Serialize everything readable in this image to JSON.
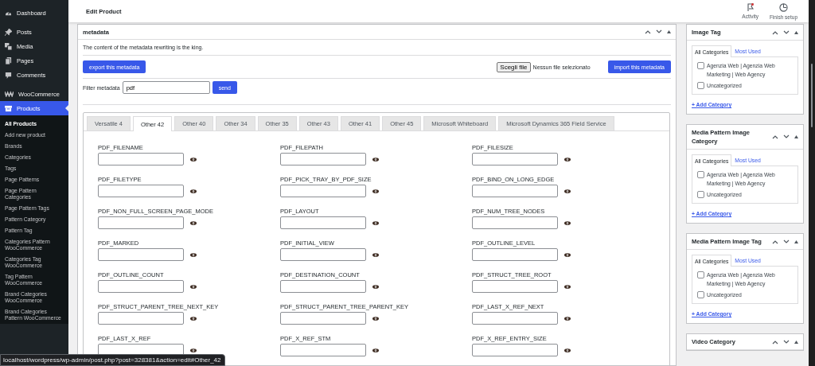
{
  "sidebar": {
    "menu": [
      {
        "label": "Dashboard",
        "kind": "dashboard",
        "selected": false
      },
      {
        "label": "Posts",
        "kind": "posts",
        "selected": false
      },
      {
        "label": "Media",
        "kind": "media",
        "selected": false
      },
      {
        "label": "Pages",
        "kind": "pages",
        "selected": false
      },
      {
        "label": "Comments",
        "kind": "comments",
        "selected": false
      },
      {
        "label": "WooCommerce",
        "kind": "woo",
        "selected": false
      },
      {
        "label": "Products",
        "kind": "products",
        "selected": true
      }
    ],
    "submenu": [
      {
        "label": "All Products",
        "selected": true
      },
      {
        "label": "Add new product",
        "selected": false
      },
      {
        "label": "Brands",
        "selected": false
      },
      {
        "label": "Categories",
        "selected": false
      },
      {
        "label": "Tags",
        "selected": false
      },
      {
        "label": "Page Patterns",
        "selected": false
      },
      {
        "label": "Page Pattern Categories",
        "selected": false
      },
      {
        "label": "Page Pattern Tags",
        "selected": false
      },
      {
        "label": "Pattern Category",
        "selected": false
      },
      {
        "label": "Pattern Tag",
        "selected": false
      },
      {
        "label": "Categories Pattern WooCommerce",
        "selected": false
      },
      {
        "label": "Categories Tag WooCommerce",
        "selected": false
      },
      {
        "label": "Tag Pattern WooCommerce",
        "selected": false
      },
      {
        "label": "Brand Categories WooCommerce",
        "selected": false
      },
      {
        "label": "Brand Categories Pattern WooCommerce",
        "selected": false
      }
    ]
  },
  "header": {
    "title": "Edit Product",
    "actions": [
      {
        "label": "Activity",
        "kind": "activity",
        "unread": true
      },
      {
        "label": "Finish setup",
        "kind": "setup"
      }
    ]
  },
  "metabox": {
    "title": "metadata",
    "description": "The content of the metadata rewriting is the king.",
    "export_button": "export this metadata",
    "file_button": "Scegli file",
    "file_status": "Nessun file selezionato",
    "import_button": "import this metadata",
    "filter": {
      "label": "Filter metadata",
      "value": "pdf",
      "button": "send"
    },
    "tabs": [
      {
        "label": "Versatile 4",
        "selected": false
      },
      {
        "label": "Other 42",
        "selected": true
      },
      {
        "label": "Other 40",
        "selected": false
      },
      {
        "label": "Other 34",
        "selected": false
      },
      {
        "label": "Other 35",
        "selected": false
      },
      {
        "label": "Other 43",
        "selected": false
      },
      {
        "label": "Other 41",
        "selected": false
      },
      {
        "label": "Other 45",
        "selected": false
      },
      {
        "label": "Microsoft Whiteboard",
        "selected": false
      },
      {
        "label": "Microsoft Dynamics 365 Field Service",
        "selected": false
      }
    ],
    "fields": [
      "PDF_FILENAME",
      "PDF_FILEPATH",
      "PDF_FILESIZE",
      "PDF_FILETYPE",
      "PDF_PICK_TRAY_BY_PDF_SIZE",
      "PDF_BIND_ON_LONG_EDGE",
      "PDF_NON_FULL_SCREEN_PAGE_MODE",
      "PDF_LAYOUT",
      "PDF_NUM_TREE_NODES",
      "PDF_MARKED",
      "PDF_INITIAL_VIEW",
      "PDF_OUTLINE_LEVEL",
      "PDF_OUTLINE_COUNT",
      "PDF_DESTINATION_COUNT",
      "PDF_STRUCT_TREE_ROOT",
      "PDF_STRUCT_PARENT_TREE_NEXT_KEY",
      "PDF_STRUCT_PARENT_TREE_PARENT_KEY",
      "PDF_LAST_X_REF_NEXT",
      "PDF_LAST_X_REF",
      "PDF_X_REF_STM",
      "PDF_X_REF_ENTRY_SIZE"
    ]
  },
  "side_panels": [
    {
      "title": "Image Tag",
      "tabs": [
        {
          "label": "All Categories",
          "selected": true
        },
        {
          "label": "Most Used",
          "selected": false
        }
      ],
      "options": [
        {
          "label": "Agenzia Web | Agenzia Web Marketing | Web Agency",
          "checked": false
        },
        {
          "label": "Uncategorized",
          "checked": false
        }
      ],
      "add_link": "+ Add Category"
    },
    {
      "title": "Media Pattern Image Category",
      "tabs": [
        {
          "label": "All Categories",
          "selected": true
        },
        {
          "label": "Most Used",
          "selected": false
        }
      ],
      "options": [
        {
          "label": "Agenzia Web | Agenzia Web Marketing | Web Agency",
          "checked": false
        },
        {
          "label": "Uncategorized",
          "checked": false
        }
      ],
      "add_link": "+ Add Category"
    },
    {
      "title": "Media Pattern Image Tag",
      "tabs": [
        {
          "label": "All Categories",
          "selected": true
        },
        {
          "label": "Most Used",
          "selected": false
        }
      ],
      "options": [
        {
          "label": "Agenzia Web | Agenzia Web Marketing | Web Agency",
          "checked": false
        },
        {
          "label": "Uncategorized",
          "checked": false
        }
      ],
      "add_link": "+ Add Category"
    },
    {
      "title": "Video Category"
    }
  ],
  "status_url": "localhost/wordpress/wp-admin/post.php?post=328381&action=edit#Other_42"
}
